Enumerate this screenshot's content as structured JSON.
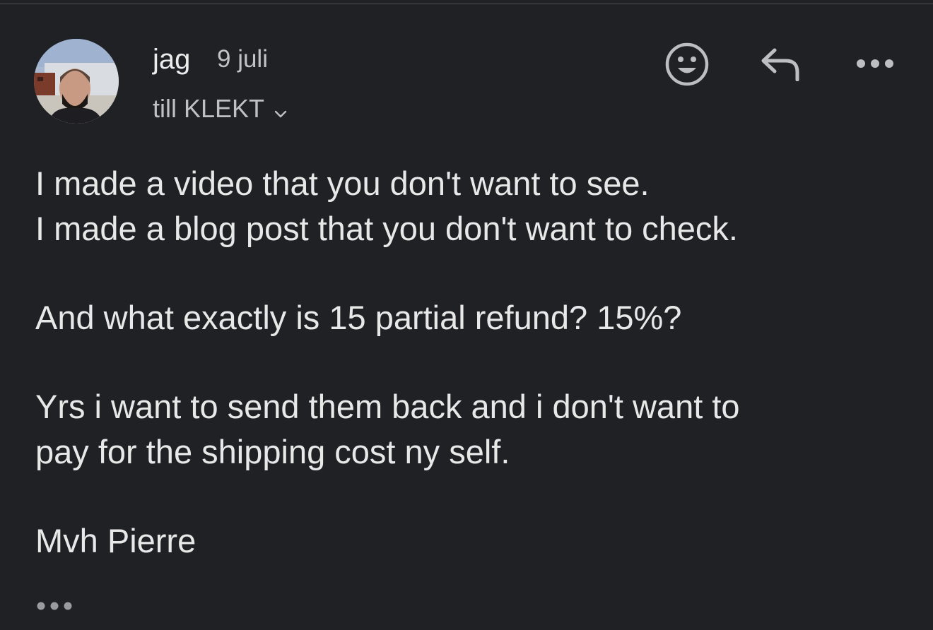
{
  "message": {
    "sender": "jag",
    "date": "9 juli",
    "recipient_label": "till KLEKT",
    "body": {
      "line1": "I made a video that you don't want to see.",
      "line2": "I made a blog post that you don't want to check.",
      "line3": "And what exactly is 15 partial refund? 15%?",
      "line4": "Yrs i want to send them back and i don't want to",
      "line5": "pay for the shipping cost ny self.",
      "signature": "Mvh Pierre"
    }
  },
  "actions": {
    "emoji_icon": "smiley-icon",
    "reply_icon": "reply-arrow-icon",
    "more_icon": "more-horizontal-icon",
    "expand_icon": "ellipsis-icon"
  },
  "colors": {
    "background": "#202124",
    "text": "#e8e8e8",
    "secondary_text": "#bfc0c3",
    "icon": "#bdbec1"
  }
}
